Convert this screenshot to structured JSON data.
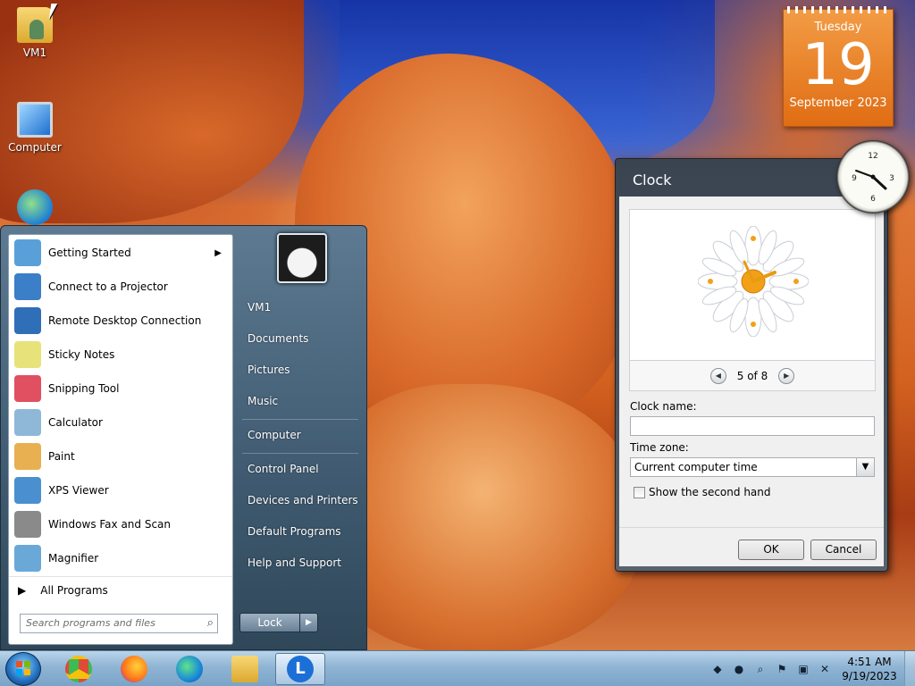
{
  "desktop": {
    "icons": [
      {
        "label": "VM1"
      },
      {
        "label": "Computer"
      }
    ]
  },
  "calendar": {
    "weekday": "Tuesday",
    "day": "19",
    "month_year": "September 2023"
  },
  "clock_dialog": {
    "title": "Clock",
    "pager": "5 of 8",
    "prev_icon": "◀",
    "next_icon": "▶",
    "clock_name_label": "Clock name:",
    "clock_name_value": "",
    "time_zone_label": "Time zone:",
    "time_zone_value": "Current computer time",
    "second_hand_label": "Show the second hand",
    "ok_label": "OK",
    "cancel_label": "Cancel"
  },
  "start_menu": {
    "programs": [
      {
        "label": "Getting Started",
        "color": "#5aa0d8",
        "has_submenu": true
      },
      {
        "label": "Connect to a Projector",
        "color": "#3a7fc8"
      },
      {
        "label": "Remote Desktop Connection",
        "color": "#2f6fb8"
      },
      {
        "label": "Sticky Notes",
        "color": "#e8e27a"
      },
      {
        "label": "Snipping Tool",
        "color": "#e05060"
      },
      {
        "label": "Calculator",
        "color": "#8fb8d8"
      },
      {
        "label": "Paint",
        "color": "#e8b050"
      },
      {
        "label": "XPS Viewer",
        "color": "#4a90d0"
      },
      {
        "label": "Windows Fax and Scan",
        "color": "#8a8a8a"
      },
      {
        "label": "Magnifier",
        "color": "#6aa8d8"
      }
    ],
    "all_programs": "All Programs",
    "search_placeholder": "Search programs and files",
    "right_items": [
      {
        "label": "VM1"
      },
      {
        "label": "Documents"
      },
      {
        "label": "Pictures"
      },
      {
        "label": "Music"
      },
      {
        "label": "Computer"
      },
      {
        "label": "Control Panel"
      },
      {
        "label": "Devices and Printers"
      },
      {
        "label": "Default Programs"
      },
      {
        "label": "Help and Support"
      }
    ],
    "lock_label": "Lock"
  },
  "taskbar": {
    "apps": [
      {
        "name": "chrome",
        "color": "#dd4b39"
      },
      {
        "name": "firefox",
        "color": "#ff7a1a"
      },
      {
        "name": "edge",
        "color": "#1a8ad8"
      },
      {
        "name": "explorer",
        "color": "#e8c050"
      },
      {
        "name": "active-app",
        "color": "#1c6fd6"
      }
    ],
    "time": "4:51 AM",
    "date": "9/19/2023"
  }
}
